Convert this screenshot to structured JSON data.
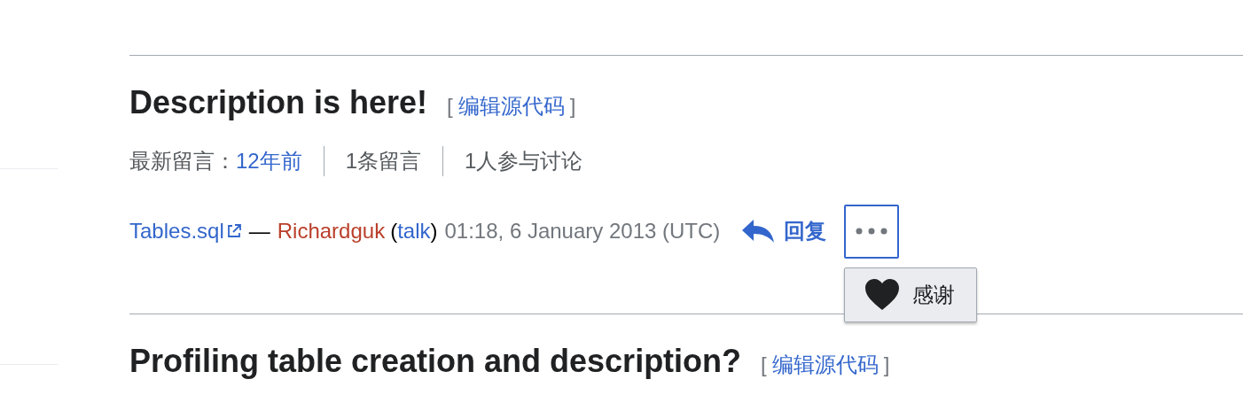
{
  "topics": [
    {
      "heading": "Description is here!",
      "edit_link": {
        "open": "[",
        "label": "编辑源代码",
        "close": "]"
      },
      "meta": {
        "latest_label": "最新留言：",
        "latest_link": "12年前",
        "comments": "1条留言",
        "participants": "1人参与讨论"
      },
      "comment": {
        "link": "Tables.sql",
        "dash": "—",
        "user": "Richardguk",
        "open_paren": "(",
        "talk": "talk",
        "close_paren": ")",
        "timestamp": "01:18, 6 January 2013 (UTC)",
        "reply": "回复",
        "more_active": true,
        "menu": {
          "open": true,
          "items": [
            {
              "label": "感谢"
            }
          ]
        }
      }
    },
    {
      "heading": "Profiling table creation and description?",
      "edit_link": {
        "open": "[",
        "label": "编辑源代码",
        "close": "]"
      }
    }
  ]
}
